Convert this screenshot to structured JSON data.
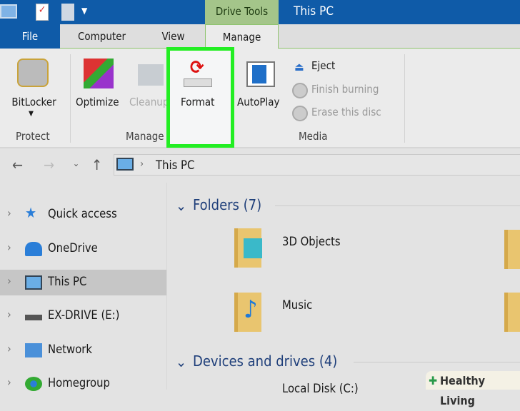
{
  "titlebar": {
    "contextual_tab": "Drive Tools",
    "title": "This PC"
  },
  "tabs": [
    "File",
    "Computer",
    "View",
    "Manage"
  ],
  "ribbon": {
    "protect": {
      "bitlocker": "BitLocker",
      "group": "Protect"
    },
    "manage": {
      "optimize": "Optimize",
      "cleanup": "Cleanup",
      "format": "Format",
      "group": "Manage"
    },
    "media": {
      "autoplay": "AutoPlay",
      "eject": "Eject",
      "finish_burning": "Finish burning",
      "erase_disc": "Erase this disc",
      "group": "Media"
    },
    "highlight_color": "#22ee22"
  },
  "address": {
    "path": "This PC"
  },
  "sidebar": [
    {
      "label": "Quick access"
    },
    {
      "label": "OneDrive"
    },
    {
      "label": "This PC"
    },
    {
      "label": "EX-DRIVE (E:)"
    },
    {
      "label": "Network"
    },
    {
      "label": "Homegroup"
    }
  ],
  "main": {
    "folders_header": "Folders (7)",
    "folders": [
      "3D Objects",
      "Music"
    ],
    "devices_header": "Devices and drives (4)",
    "device_partial": "Local Disk (C:)"
  },
  "watermark": "Healthy Living"
}
